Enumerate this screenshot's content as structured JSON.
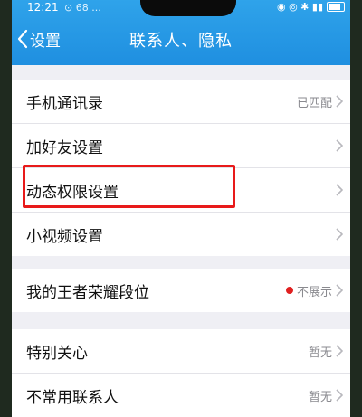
{
  "status_bar": {
    "time": "12:21",
    "extra": "⊙ 68 ...",
    "right": "◉ ◎ ✱ ▮▮"
  },
  "header": {
    "back_label": "设置",
    "title": "联系人、隐私"
  },
  "groups": [
    {
      "items": [
        {
          "label": "手机通讯录",
          "value": "已匹配"
        },
        {
          "label": "加好友设置",
          "value": ""
        },
        {
          "label": "动态权限设置",
          "value": ""
        },
        {
          "label": "小视频设置",
          "value": ""
        }
      ]
    },
    {
      "items": [
        {
          "label": "我的王者荣耀段位",
          "value": "不展示",
          "dot_color": "#e02020"
        }
      ]
    },
    {
      "items": [
        {
          "label": "特别关心",
          "value": "暂无"
        },
        {
          "label": "不常用联系人",
          "value": "暂无"
        }
      ]
    }
  ],
  "colors": {
    "header": "#1f8fe0",
    "highlight": "#e81a1a",
    "background": "#efeff4"
  }
}
